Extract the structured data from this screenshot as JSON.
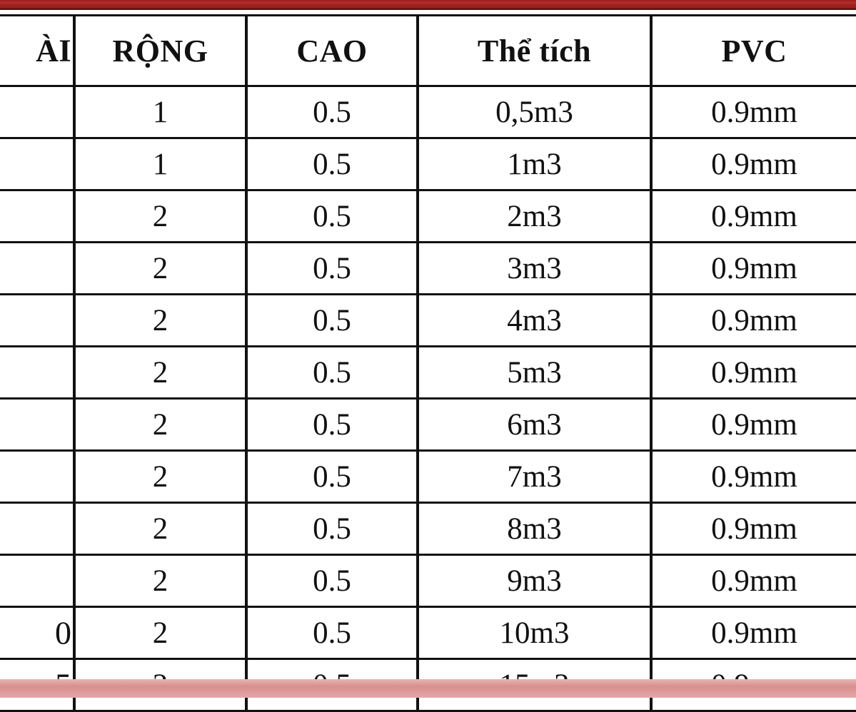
{
  "decor": {
    "top_band_color": "#9e2020",
    "bottom_band_color": "#d98f8f",
    "grid_color": "#111111",
    "shade_color": "#eeeeee"
  },
  "table": {
    "headers": [
      {
        "label": "ÀI",
        "clipped": true
      },
      {
        "label": "RỘNG",
        "clipped": false
      },
      {
        "label": "CAO",
        "clipped": false
      },
      {
        "label": "Thể tích",
        "clipped": false
      },
      {
        "label": "PVC",
        "clipped": false
      }
    ],
    "rows": [
      {
        "dai": "",
        "rong": "1",
        "cao": "0.5",
        "the_tich": "0,5m3",
        "pvc": "0.9mm",
        "shaded": false
      },
      {
        "dai": "",
        "rong": "1",
        "cao": "0.5",
        "the_tich": "1m3",
        "pvc": "0.9mm",
        "shaded": true
      },
      {
        "dai": "",
        "rong": "2",
        "cao": "0.5",
        "the_tich": "2m3",
        "pvc": "0.9mm",
        "shaded": true
      },
      {
        "dai": "",
        "rong": "2",
        "cao": "0.5",
        "the_tich": "3m3",
        "pvc": "0.9mm",
        "shaded": false
      },
      {
        "dai": "",
        "rong": "2",
        "cao": "0.5",
        "the_tich": "4m3",
        "pvc": "0.9mm",
        "shaded": true
      },
      {
        "dai": "",
        "rong": "2",
        "cao": "0.5",
        "the_tich": "5m3",
        "pvc": "0.9mm",
        "shaded": false
      },
      {
        "dai": "",
        "rong": "2",
        "cao": "0.5",
        "the_tich": "6m3",
        "pvc": "0.9mm",
        "shaded": true
      },
      {
        "dai": "",
        "rong": "2",
        "cao": "0.5",
        "the_tich": "7m3",
        "pvc": "0.9mm",
        "shaded": false
      },
      {
        "dai": "",
        "rong": "2",
        "cao": "0.5",
        "the_tich": "8m3",
        "pvc": "0.9mm",
        "shaded": true
      },
      {
        "dai": "",
        "rong": "2",
        "cao": "0.5",
        "the_tich": "9m3",
        "pvc": "0.9mm",
        "shaded": false
      },
      {
        "dai": "0",
        "rong": "2",
        "cao": "0.5",
        "the_tich": "10m3",
        "pvc": "0.9mm",
        "shaded": true
      },
      {
        "dai": "5",
        "rong": "2",
        "cao": "0.5",
        "the_tich": "15m3",
        "pvc": "0.9mm",
        "shaded": false
      }
    ]
  }
}
